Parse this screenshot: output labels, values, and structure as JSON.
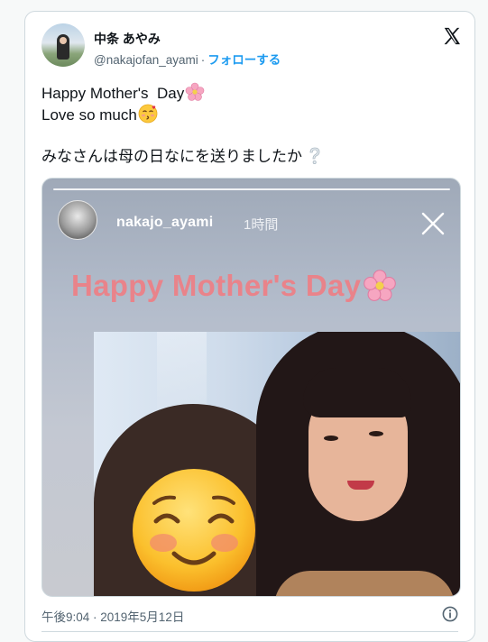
{
  "author": {
    "name": "中条 あやみ",
    "handle": "@nakajofan_ayami",
    "separator": "·",
    "follow_label": "フォローする"
  },
  "tweet": {
    "line1": "Happy Mother's  Day",
    "line2": "Love so much",
    "line3": "みなさんは母の日なにを送りましたか"
  },
  "story": {
    "username": "nakajo_ayami",
    "time": "1時間",
    "headline": "Happy  Mother's Day"
  },
  "footer": {
    "timestamp": "午後9:04 · 2019年5月12日"
  },
  "icons": {
    "brand": "x-logo-icon",
    "flower": "cherry-blossom-icon",
    "kiss": "kissing-face-icon",
    "question": "white-question-icon",
    "close": "close-icon",
    "info": "info-icon",
    "cover": "smiling-face-icon"
  },
  "colors": {
    "link": "#1d9bf0",
    "headline": "#e9838a"
  }
}
